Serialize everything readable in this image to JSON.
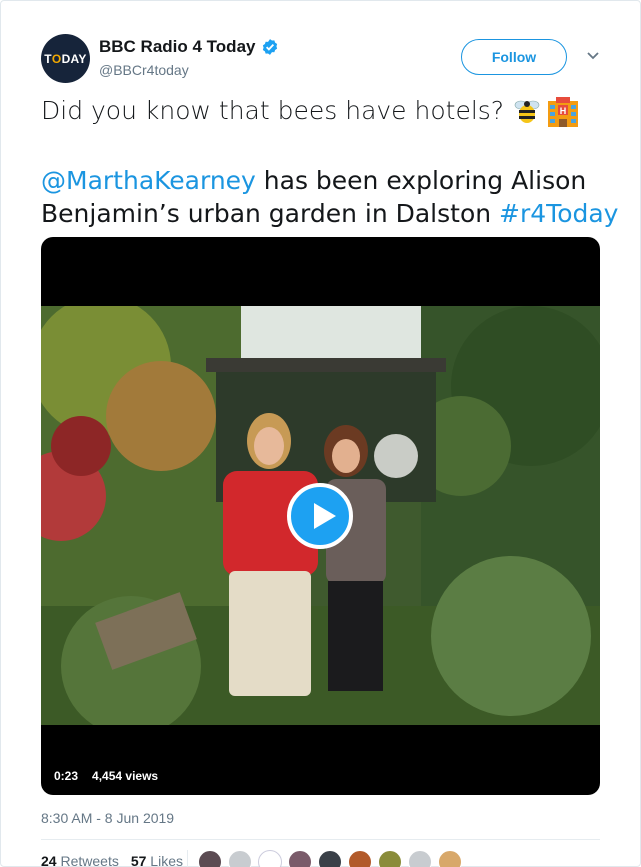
{
  "account": {
    "avatar_text_pre": "T",
    "avatar_text_o": "O",
    "avatar_text_post": "DAY",
    "display_name": "BBC Radio 4 Today",
    "handle": "@BBCr4today",
    "verified": true
  },
  "header": {
    "follow_label": "Follow",
    "caret_icon": "chevron-down-icon"
  },
  "tweet": {
    "line1": "Did you know that bees have hotels?",
    "emoji1": "bee-icon",
    "emoji2": "hotel-icon",
    "mention": "@MarthaKearney",
    "text_mid": " has been exploring Alison Benjamin’s urban garden in Dalston ",
    "hashtag": "#r4Today"
  },
  "video": {
    "duration": "0:23",
    "views": "4,454 views",
    "play_icon": "play-icon"
  },
  "timestamp": "8:30 AM - 8 Jun 2019",
  "stats": {
    "retweets_count": "24",
    "retweets_label": "Retweets",
    "likes_count": "57",
    "likes_label": "Likes"
  },
  "colors": {
    "link": "#1b95e0",
    "text": "#14171a",
    "muted": "#657786",
    "play": "#1da1f2"
  }
}
